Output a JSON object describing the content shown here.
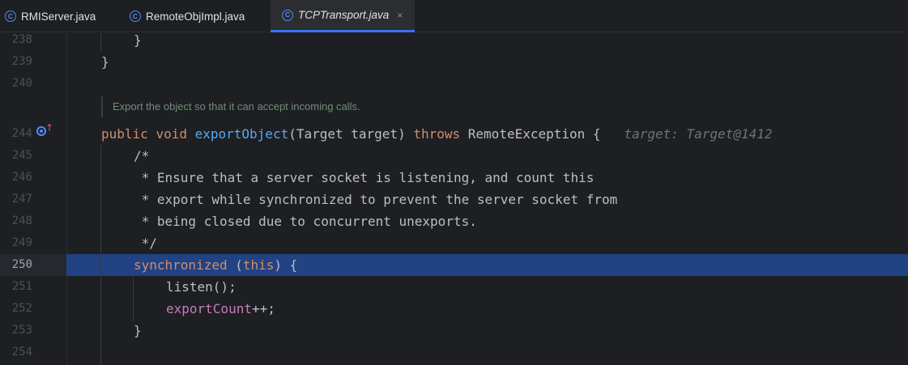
{
  "tabs": [
    {
      "label": "RMIServer.java",
      "icon": "class-icon",
      "active": false
    },
    {
      "label": "RemoteObjImpl.java",
      "icon": "class-icon",
      "active": false
    },
    {
      "label": "TCPTransport.java",
      "icon": "class-icon",
      "active": true,
      "close": "×"
    }
  ],
  "editor": {
    "doc_comment": "Export the object so that it can accept incoming calls.",
    "inlay_hint": "target: Target@1412",
    "current_line": "250",
    "lines": [
      {
        "num": "238",
        "code": "}"
      },
      {
        "num": "239",
        "code": "}"
      },
      {
        "num": "240",
        "code": ""
      },
      {
        "num": "244",
        "code_parts": [
          "public",
          "void",
          "exportObject",
          "(Target target)",
          "throws",
          "RemoteException {"
        ]
      },
      {
        "num": "245",
        "code": "/*"
      },
      {
        "num": "246",
        "code": " * Ensure that a server socket is listening, and count this"
      },
      {
        "num": "247",
        "code": " * export while synchronized to prevent the server socket from"
      },
      {
        "num": "248",
        "code": " * being closed due to concurrent unexports."
      },
      {
        "num": "249",
        "code": " */"
      },
      {
        "num": "250",
        "code_parts": [
          "synchronized",
          "(",
          "this",
          ") {"
        ]
      },
      {
        "num": "251",
        "code": "listen();"
      },
      {
        "num": "252",
        "code_parts": [
          "exportCount",
          "++;"
        ]
      },
      {
        "num": "253",
        "code": "}"
      },
      {
        "num": "254",
        "code": ""
      }
    ]
  },
  "colors": {
    "keyword": "#cf8e6d",
    "function": "#56a8f5",
    "comment": "#5fb93e",
    "field": "#c77dbb",
    "selection": "#214283",
    "accent": "#3574f0"
  }
}
